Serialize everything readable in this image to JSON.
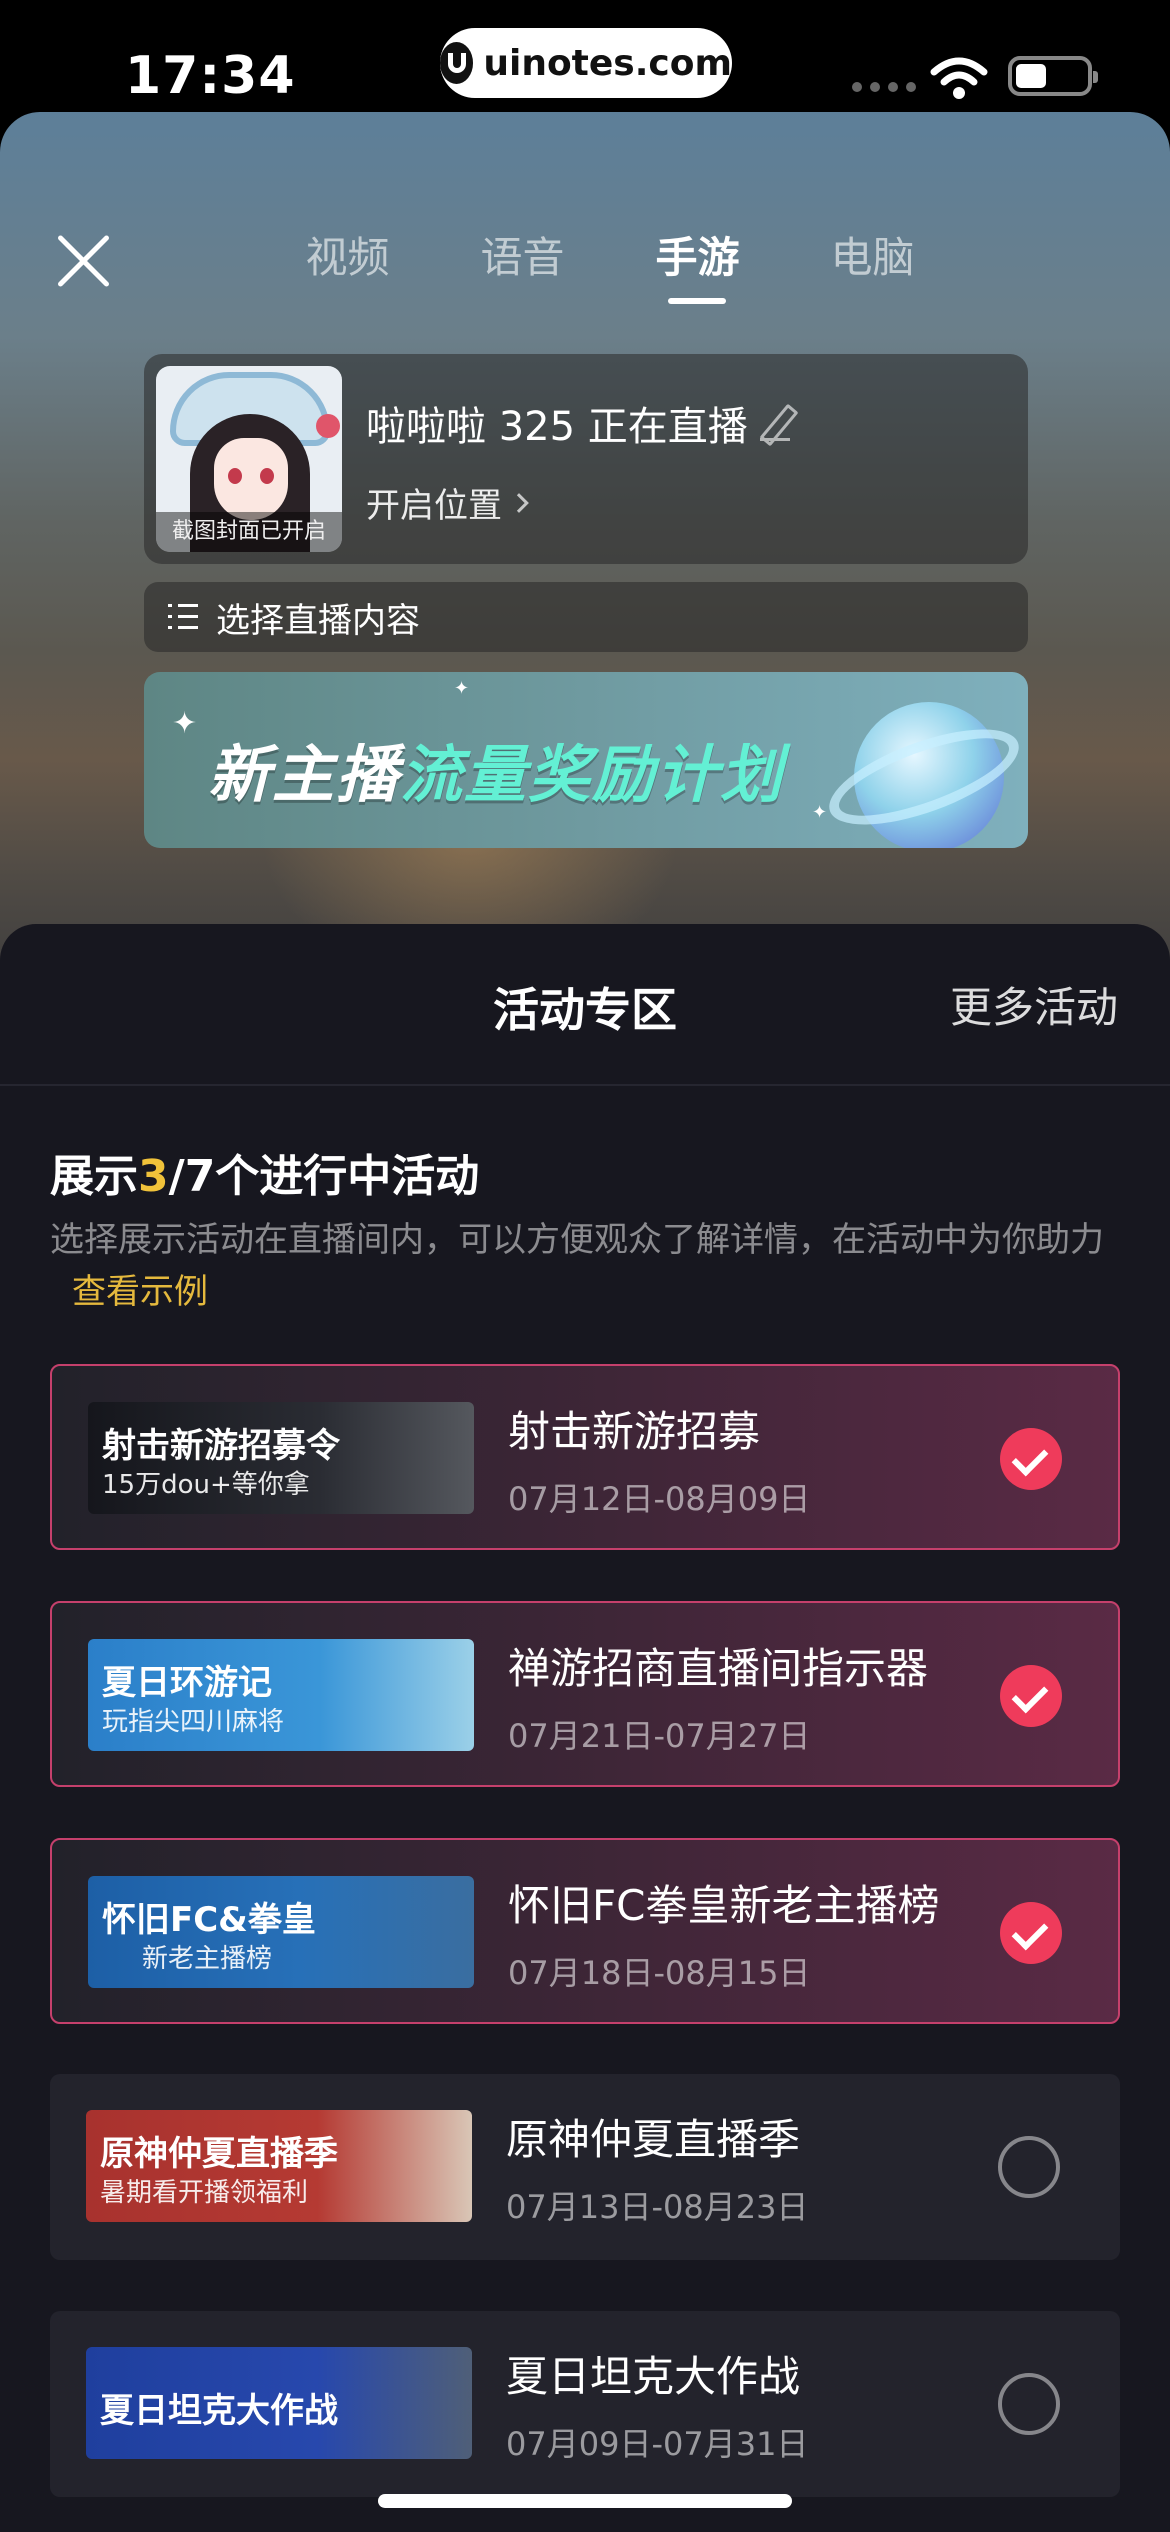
{
  "status_bar": {
    "time": "17:34",
    "url": "uinotes.com"
  },
  "tabs": [
    {
      "label": "视频",
      "active": false
    },
    {
      "label": "语音",
      "active": false
    },
    {
      "label": "手游",
      "active": true
    },
    {
      "label": "电脑",
      "active": false
    }
  ],
  "profile": {
    "room_title": "啦啦啦 325 正在直播",
    "cover_caption": "截图封面已开启",
    "location": "开启位置"
  },
  "content_select": {
    "label": "选择直播内容"
  },
  "banner": {
    "text_main": "新主播",
    "text_highlight": "流量奖励计划",
    "accent": "#63f0d4"
  },
  "panel": {
    "title": "活动专区",
    "more": "更多活动",
    "show_prefix": "展示",
    "show_count": "3",
    "show_suffix": "/7个进行中活动",
    "description": "选择展示活动在直播间内，可以方便观众了解详情，在活动中为你助力",
    "example_link": "查看示例"
  },
  "activities": [
    {
      "name": "射击新游招募",
      "date": "07月12日-08月09日",
      "selected": true,
      "thumb_title": "射击新游招募令",
      "thumb_sub": "15万dou+等你拿"
    },
    {
      "name": "禅游招商直播间指示器",
      "date": "07月21日-07月27日",
      "selected": true,
      "thumb_title": "夏日环游记",
      "thumb_sub": "玩指尖四川麻将"
    },
    {
      "name": "怀旧FC拳皇新老主播榜",
      "date": "07月18日-08月15日",
      "selected": true,
      "thumb_title": "怀旧FC&拳皇",
      "thumb_sub": "新老主播榜"
    },
    {
      "name": "原神仲夏直播季",
      "date": "07月13日-08月23日",
      "selected": false,
      "thumb_title": "原神仲夏直播季",
      "thumb_sub": "暑期看开播领福利"
    },
    {
      "name": "夏日坦克大作战",
      "date": "07月09日-07月31日",
      "selected": false,
      "thumb_title": "夏日坦克大作战",
      "thumb_sub": ""
    }
  ],
  "colors": {
    "selected_check": "#ef3b5b",
    "count_highlight": "#f0c23a",
    "panel_bg": "#17171f"
  }
}
